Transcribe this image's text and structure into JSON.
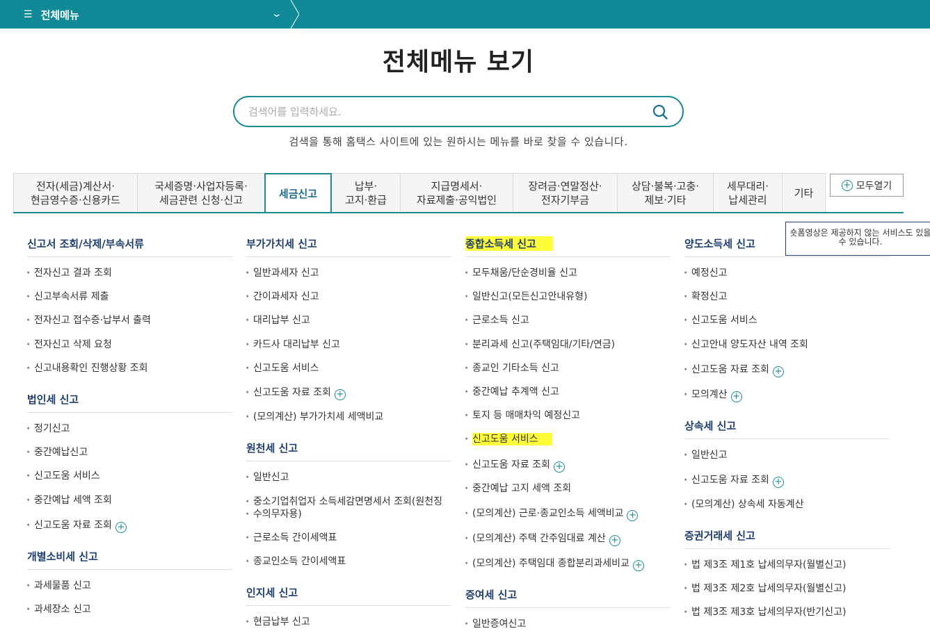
{
  "topbar": {
    "menu_label": "전체메뉴"
  },
  "page": {
    "title": "전체메뉴 보기"
  },
  "search": {
    "placeholder": "검색어를 입력하세요.",
    "help": "검색을 통해 홈택스 사이트에 있는 원하시는 메뉴를 바로 찾을 수 있습니다."
  },
  "tabs": [
    {
      "label": "전자(세금)계산서·\n현금영수증·신용카드"
    },
    {
      "label": "국세증명·사업자등록·\n세금관련 신청·신고"
    },
    {
      "label": "세금신고",
      "active": true
    },
    {
      "label": "납부·\n고지·환급"
    },
    {
      "label": "지급명세서·\n자료제출·공익법인"
    },
    {
      "label": "장려금·연말정산·\n전자기부금"
    },
    {
      "label": "상담·불복·고충·\n제보·기타"
    },
    {
      "label": "세무대리·\n납세관리"
    },
    {
      "label": "기타"
    }
  ],
  "open_all_label": "모두열기",
  "tooltip_text": "숏폼영상은 제공하지 않는 서비스도 있을 수 있습니다.",
  "columns": {
    "col1": {
      "s1": {
        "title": "신고서 조회/삭제/부속서류",
        "items": [
          "전자신고 결과 조회",
          "신고부속서류 제출",
          "전자신고 접수증·납부서 출력",
          "전자신고 삭제 요청",
          "신고내용확인 진행상황 조회"
        ]
      },
      "s2": {
        "title": "법인세 신고",
        "items": [
          "정기신고",
          "중간예납신고",
          "신고도움 서비스",
          "중간예납 세액 조회",
          "신고도움 자료 조회"
        ]
      },
      "s3": {
        "title": "개별소비세 신고",
        "items": [
          "과세물품 신고",
          "과세장소 신고"
        ]
      }
    },
    "col2": {
      "s1": {
        "title": "부가가치세 신고",
        "items": [
          "일반과세자 신고",
          "간이과세자 신고",
          "대리납부 신고",
          "카드사 대리납부 신고",
          "신고도움 서비스",
          "신고도움 자료 조회",
          "(모의계산) 부가가치세 세액비교"
        ]
      },
      "s2": {
        "title": "원천세 신고",
        "items": [
          "일반신고",
          "중소기업취업자 소득세감면명세서 조회(원천징",
          "수의무자용)",
          "근로소득 간이세액표",
          "종교인소득 간이세액표"
        ]
      },
      "s3": {
        "title": "인지세 신고",
        "items": [
          "현금납부 신고"
        ]
      }
    },
    "col3": {
      "s1": {
        "title": "종합소득세 신고",
        "items": [
          "모두채움/단순경비율 신고",
          "일반신고(모든신고안내유형)",
          "근로소득 신고",
          "분리과세 신고(주택임대/기타/연금)",
          "종교인 기타소득 신고",
          "중간예납 추계액 신고",
          "토지 등 매매차익 예정신고",
          "신고도움 서비스",
          "신고도움 자료 조회",
          "중간예납 고지 세액 조회",
          "(모의계산) 근로·종교인소득 세액비교",
          "(모의계산) 주택 간주임대료 계산",
          "(모의계산) 주택임대 종합분리과세비교"
        ]
      },
      "s2": {
        "title": "증여세 신고",
        "items": [
          "일반증여신고"
        ]
      }
    },
    "col4": {
      "s1": {
        "title": "양도소득세 신고",
        "items": [
          "예정신고",
          "확정신고",
          "신고도움 서비스",
          "신고안내 양도자산 내역 조회",
          "신고도움 자료 조회",
          "모의계산"
        ]
      },
      "s2": {
        "title": "상속세 신고",
        "items": [
          "일반신고",
          "신고도움 자료 조회",
          "(모의계산) 상속세 자동계산"
        ]
      },
      "s3": {
        "title": "증권거래세 신고",
        "items": [
          "법 제3조 제1호 납세의무자(월별신고)",
          "법 제3조 제2호 납세의무자(월별신고)",
          "법 제3조 제3호 납세의무자(반기신고)"
        ]
      }
    }
  },
  "colors": {
    "brand": "#0f8a96",
    "section_title": "#1e3f6f",
    "highlight": "#fffc3a"
  }
}
